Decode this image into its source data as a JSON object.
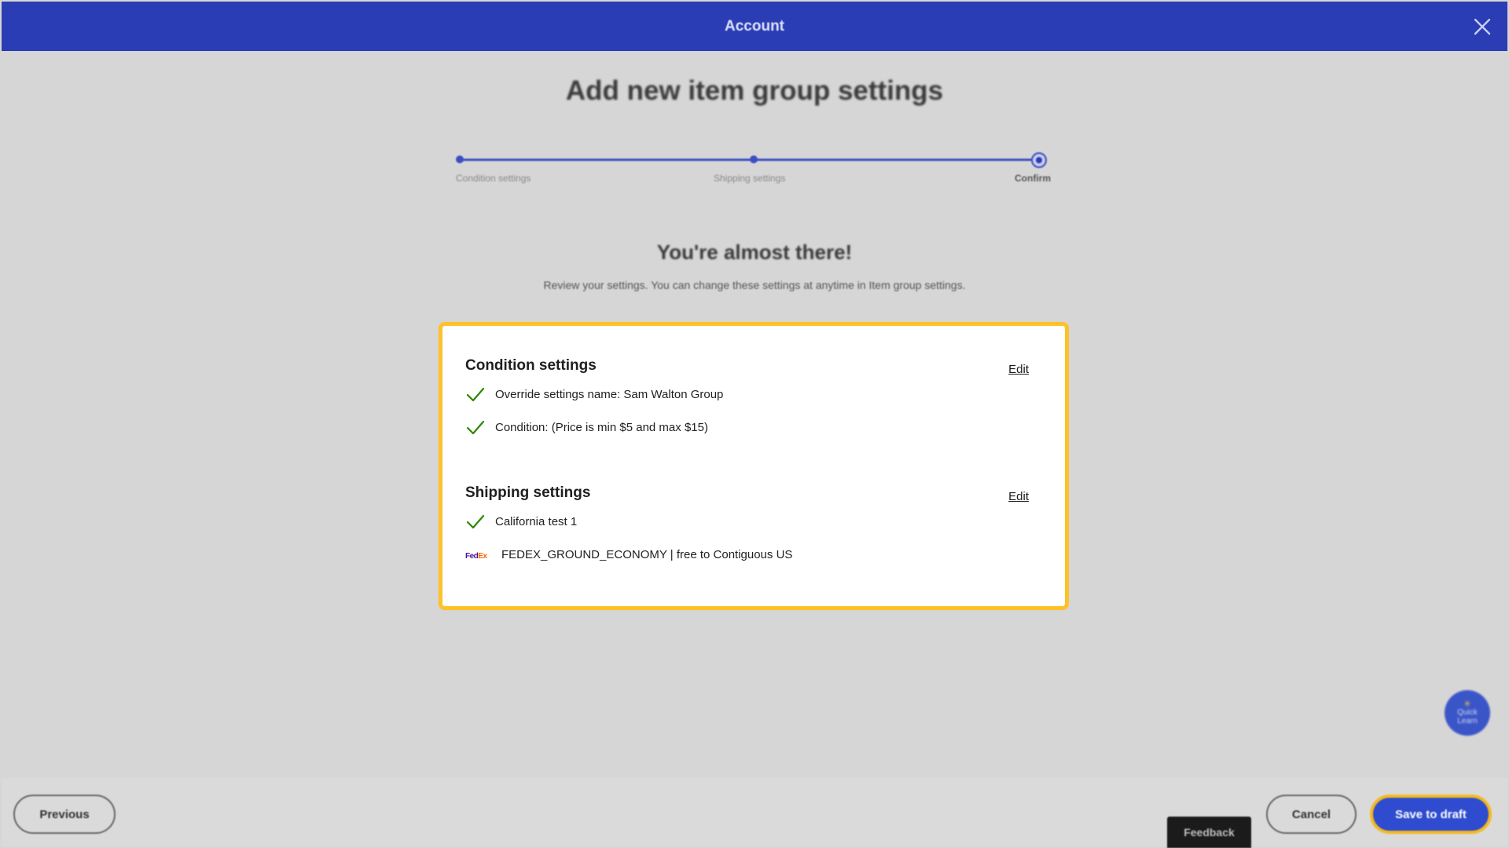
{
  "header": {
    "title": "Account"
  },
  "page": {
    "title": "Add new item group settings"
  },
  "stepper": {
    "steps": [
      {
        "label": "Condition settings"
      },
      {
        "label": "Shipping settings"
      },
      {
        "label": "Confirm"
      }
    ],
    "current_step": 3
  },
  "intro": {
    "title": "You're almost there!",
    "subtitle": "Review your settings. You can change these settings at anytime in Item group settings."
  },
  "summary": {
    "condition": {
      "title": "Condition settings",
      "edit_label": "Edit",
      "items": [
        {
          "text": "Override settings name: Sam Walton Group",
          "icon": "check-icon"
        },
        {
          "text": "Condition: (Price is min $5 and max $15)",
          "icon": "check-icon"
        }
      ]
    },
    "shipping": {
      "title": "Shipping settings",
      "edit_label": "Edit",
      "items": [
        {
          "text": "California test 1",
          "icon": "check-icon"
        },
        {
          "text": "FEDEX_GROUND_ECONOMY | free to Contiguous US",
          "icon": "fedex-logo-icon",
          "logo_text": [
            "Fed",
            "Ex"
          ]
        }
      ]
    }
  },
  "quick_learn": {
    "label_line1": "Quick",
    "label_line2": "Learn"
  },
  "footer": {
    "previous_label": "Previous",
    "cancel_label": "Cancel",
    "save_label": "Save to draft",
    "feedback_label": "Feedback"
  },
  "colors": {
    "header_bg": "#2a3db5",
    "accent_yellow": "#fec127",
    "primary_blue": "#2f4cd0",
    "check_green": "#2a8703",
    "backdrop": "#d6d6d6"
  }
}
